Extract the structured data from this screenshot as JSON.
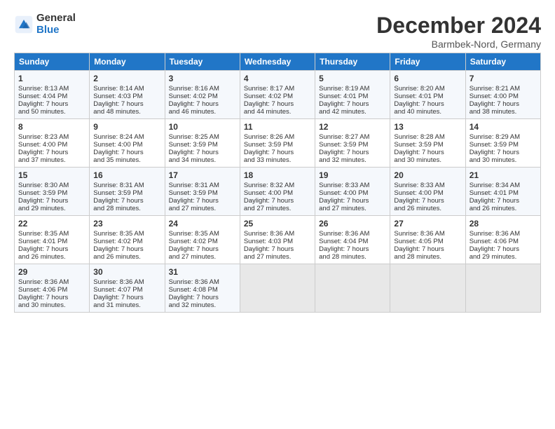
{
  "logo": {
    "general": "General",
    "blue": "Blue"
  },
  "header": {
    "month": "December 2024",
    "location": "Barmbek-Nord, Germany"
  },
  "weekdays": [
    "Sunday",
    "Monday",
    "Tuesday",
    "Wednesday",
    "Thursday",
    "Friday",
    "Saturday"
  ],
  "weeks": [
    [
      {
        "day": "1",
        "lines": [
          "Sunrise: 8:13 AM",
          "Sunset: 4:04 PM",
          "Daylight: 7 hours",
          "and 50 minutes."
        ]
      },
      {
        "day": "2",
        "lines": [
          "Sunrise: 8:14 AM",
          "Sunset: 4:03 PM",
          "Daylight: 7 hours",
          "and 48 minutes."
        ]
      },
      {
        "day": "3",
        "lines": [
          "Sunrise: 8:16 AM",
          "Sunset: 4:02 PM",
          "Daylight: 7 hours",
          "and 46 minutes."
        ]
      },
      {
        "day": "4",
        "lines": [
          "Sunrise: 8:17 AM",
          "Sunset: 4:02 PM",
          "Daylight: 7 hours",
          "and 44 minutes."
        ]
      },
      {
        "day": "5",
        "lines": [
          "Sunrise: 8:19 AM",
          "Sunset: 4:01 PM",
          "Daylight: 7 hours",
          "and 42 minutes."
        ]
      },
      {
        "day": "6",
        "lines": [
          "Sunrise: 8:20 AM",
          "Sunset: 4:01 PM",
          "Daylight: 7 hours",
          "and 40 minutes."
        ]
      },
      {
        "day": "7",
        "lines": [
          "Sunrise: 8:21 AM",
          "Sunset: 4:00 PM",
          "Daylight: 7 hours",
          "and 38 minutes."
        ]
      }
    ],
    [
      {
        "day": "8",
        "lines": [
          "Sunrise: 8:23 AM",
          "Sunset: 4:00 PM",
          "Daylight: 7 hours",
          "and 37 minutes."
        ]
      },
      {
        "day": "9",
        "lines": [
          "Sunrise: 8:24 AM",
          "Sunset: 4:00 PM",
          "Daylight: 7 hours",
          "and 35 minutes."
        ]
      },
      {
        "day": "10",
        "lines": [
          "Sunrise: 8:25 AM",
          "Sunset: 3:59 PM",
          "Daylight: 7 hours",
          "and 34 minutes."
        ]
      },
      {
        "day": "11",
        "lines": [
          "Sunrise: 8:26 AM",
          "Sunset: 3:59 PM",
          "Daylight: 7 hours",
          "and 33 minutes."
        ]
      },
      {
        "day": "12",
        "lines": [
          "Sunrise: 8:27 AM",
          "Sunset: 3:59 PM",
          "Daylight: 7 hours",
          "and 32 minutes."
        ]
      },
      {
        "day": "13",
        "lines": [
          "Sunrise: 8:28 AM",
          "Sunset: 3:59 PM",
          "Daylight: 7 hours",
          "and 30 minutes."
        ]
      },
      {
        "day": "14",
        "lines": [
          "Sunrise: 8:29 AM",
          "Sunset: 3:59 PM",
          "Daylight: 7 hours",
          "and 30 minutes."
        ]
      }
    ],
    [
      {
        "day": "15",
        "lines": [
          "Sunrise: 8:30 AM",
          "Sunset: 3:59 PM",
          "Daylight: 7 hours",
          "and 29 minutes."
        ]
      },
      {
        "day": "16",
        "lines": [
          "Sunrise: 8:31 AM",
          "Sunset: 3:59 PM",
          "Daylight: 7 hours",
          "and 28 minutes."
        ]
      },
      {
        "day": "17",
        "lines": [
          "Sunrise: 8:31 AM",
          "Sunset: 3:59 PM",
          "Daylight: 7 hours",
          "and 27 minutes."
        ]
      },
      {
        "day": "18",
        "lines": [
          "Sunrise: 8:32 AM",
          "Sunset: 4:00 PM",
          "Daylight: 7 hours",
          "and 27 minutes."
        ]
      },
      {
        "day": "19",
        "lines": [
          "Sunrise: 8:33 AM",
          "Sunset: 4:00 PM",
          "Daylight: 7 hours",
          "and 27 minutes."
        ]
      },
      {
        "day": "20",
        "lines": [
          "Sunrise: 8:33 AM",
          "Sunset: 4:00 PM",
          "Daylight: 7 hours",
          "and 26 minutes."
        ]
      },
      {
        "day": "21",
        "lines": [
          "Sunrise: 8:34 AM",
          "Sunset: 4:01 PM",
          "Daylight: 7 hours",
          "and 26 minutes."
        ]
      }
    ],
    [
      {
        "day": "22",
        "lines": [
          "Sunrise: 8:35 AM",
          "Sunset: 4:01 PM",
          "Daylight: 7 hours",
          "and 26 minutes."
        ]
      },
      {
        "day": "23",
        "lines": [
          "Sunrise: 8:35 AM",
          "Sunset: 4:02 PM",
          "Daylight: 7 hours",
          "and 26 minutes."
        ]
      },
      {
        "day": "24",
        "lines": [
          "Sunrise: 8:35 AM",
          "Sunset: 4:02 PM",
          "Daylight: 7 hours",
          "and 27 minutes."
        ]
      },
      {
        "day": "25",
        "lines": [
          "Sunrise: 8:36 AM",
          "Sunset: 4:03 PM",
          "Daylight: 7 hours",
          "and 27 minutes."
        ]
      },
      {
        "day": "26",
        "lines": [
          "Sunrise: 8:36 AM",
          "Sunset: 4:04 PM",
          "Daylight: 7 hours",
          "and 28 minutes."
        ]
      },
      {
        "day": "27",
        "lines": [
          "Sunrise: 8:36 AM",
          "Sunset: 4:05 PM",
          "Daylight: 7 hours",
          "and 28 minutes."
        ]
      },
      {
        "day": "28",
        "lines": [
          "Sunrise: 8:36 AM",
          "Sunset: 4:06 PM",
          "Daylight: 7 hours",
          "and 29 minutes."
        ]
      }
    ],
    [
      {
        "day": "29",
        "lines": [
          "Sunrise: 8:36 AM",
          "Sunset: 4:06 PM",
          "Daylight: 7 hours",
          "and 30 minutes."
        ]
      },
      {
        "day": "30",
        "lines": [
          "Sunrise: 8:36 AM",
          "Sunset: 4:07 PM",
          "Daylight: 7 hours",
          "and 31 minutes."
        ]
      },
      {
        "day": "31",
        "lines": [
          "Sunrise: 8:36 AM",
          "Sunset: 4:08 PM",
          "Daylight: 7 hours",
          "and 32 minutes."
        ]
      },
      null,
      null,
      null,
      null
    ]
  ]
}
